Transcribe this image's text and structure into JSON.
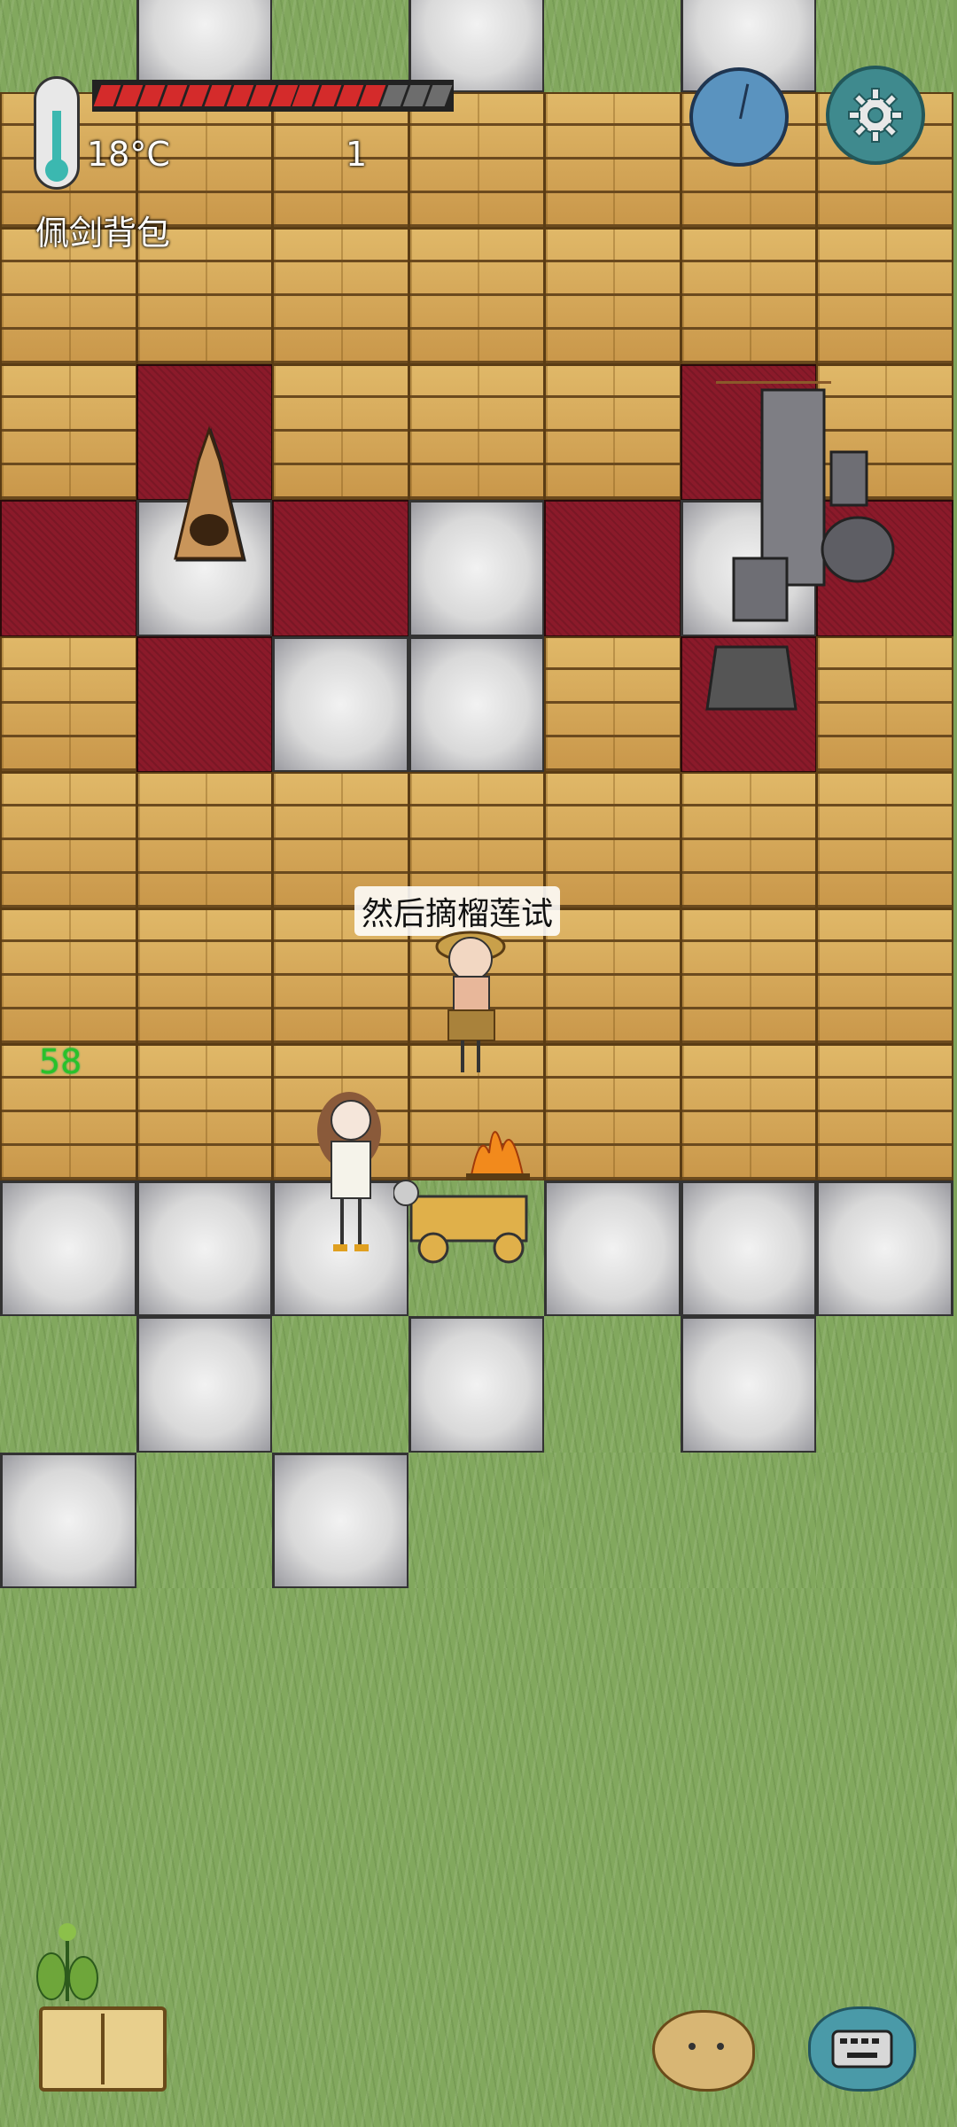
{
  "hud": {
    "temperature": "18°C",
    "counter": "1",
    "backpack_label": "佩剑背包",
    "food_segments": {
      "filled": 13,
      "empty": 3
    }
  },
  "world": {
    "speech_text": "然后摘榴莲试",
    "status_number": "58"
  },
  "icons": {
    "thermometer": "thermometer-icon",
    "clock": "clock-icon",
    "settings": "gear-icon",
    "recipe_book": "book-icon",
    "emote": "potato-emote-icon",
    "chat": "keyboard-icon"
  },
  "colors": {
    "food_filled": "#d42b2b",
    "food_empty": "#6d6d6d",
    "grass": "#82a85e",
    "wood": "#d2a455",
    "carpet": "#8b1a2a",
    "stone": "#dcdcdc"
  }
}
